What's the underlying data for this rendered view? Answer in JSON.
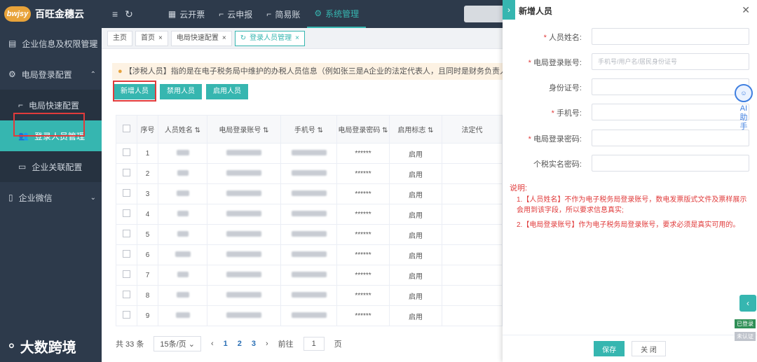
{
  "app": {
    "logo_mark": "bwjsy",
    "name": "百旺金穗云"
  },
  "top_nav": [
    {
      "label": "云开票",
      "icon": "grid-icon"
    },
    {
      "label": "云申报",
      "icon": "crop-icon"
    },
    {
      "label": "简易账",
      "icon": "crop-icon"
    },
    {
      "label": "系统管理",
      "icon": "gear-icon",
      "active": true
    }
  ],
  "sidebar": {
    "items": [
      {
        "label": "企业信息及权限管理"
      },
      {
        "label": "电局登录配置"
      },
      {
        "label": "电局快速配置"
      },
      {
        "label": "登录人员管理"
      },
      {
        "label": "企业关联配置"
      },
      {
        "label": "企业微信"
      }
    ],
    "watermark": "大数跨境"
  },
  "tabs": [
    {
      "label": "主页"
    },
    {
      "label": "首页",
      "close": "×"
    },
    {
      "label": "电局快速配置",
      "close": "×"
    },
    {
      "label": "登录人员管理",
      "close": "×",
      "active": true
    }
  ],
  "notice": {
    "text": "【涉税人员】指的是在电子税务局中维护的办税人员信息（例如张三是A企业的法定代表人，且同时是财务负责人），如"
  },
  "buttons": {
    "add": "新增人员",
    "disable": "禁用人员",
    "enable": "启用人员"
  },
  "table": {
    "headers": [
      "序号",
      "人员姓名",
      "电局登录账号",
      "手机号",
      "电局登录密码",
      "启用标志",
      "法定代"
    ],
    "rows": [
      {
        "idx": "1",
        "pwd": "******",
        "status": "启用"
      },
      {
        "idx": "2",
        "pwd": "******",
        "status": "启用"
      },
      {
        "idx": "3",
        "pwd": "******",
        "status": "启用"
      },
      {
        "idx": "4",
        "pwd": "******",
        "status": "启用"
      },
      {
        "idx": "5",
        "pwd": "******",
        "status": "启用"
      },
      {
        "idx": "6",
        "pwd": "******",
        "status": "启用"
      },
      {
        "idx": "7",
        "pwd": "******",
        "status": "启用"
      },
      {
        "idx": "8",
        "pwd": "******",
        "status": "启用"
      },
      {
        "idx": "9",
        "pwd": "******",
        "status": "启用"
      }
    ]
  },
  "pager": {
    "total": "共 33 条",
    "size": "15条/页",
    "pages": [
      "1",
      "2",
      "3"
    ],
    "goto": "前往",
    "goto_value": "1",
    "page_suffix": "页"
  },
  "drawer": {
    "title": "新增人员",
    "fields": [
      {
        "label": "人员姓名:",
        "required": true,
        "placeholder": ""
      },
      {
        "label": "电局登录账号:",
        "required": true,
        "placeholder": "手机号/用户名/居民身份证号"
      },
      {
        "label": "身份证号:",
        "required": false,
        "placeholder": ""
      },
      {
        "label": "手机号:",
        "required": true,
        "placeholder": ""
      },
      {
        "label": "电局登录密码:",
        "required": true,
        "placeholder": ""
      },
      {
        "label": "个税实名密码:",
        "required": false,
        "placeholder": ""
      }
    ],
    "note_title": "说明:",
    "notes": [
      "1.【人员姓名】不作为电子税务局登录账号，数电发票版式文件及票样展示会用到该字段，所以要求信息真实;",
      "2.【电局登录账号】作为电子税务局登录账号，要求必须是真实可用的。"
    ],
    "save": "保存",
    "close": "关 闭"
  },
  "ai_assistant": {
    "label": "AI助手"
  },
  "status": {
    "login": "已登录",
    "unverified": "未认证"
  }
}
